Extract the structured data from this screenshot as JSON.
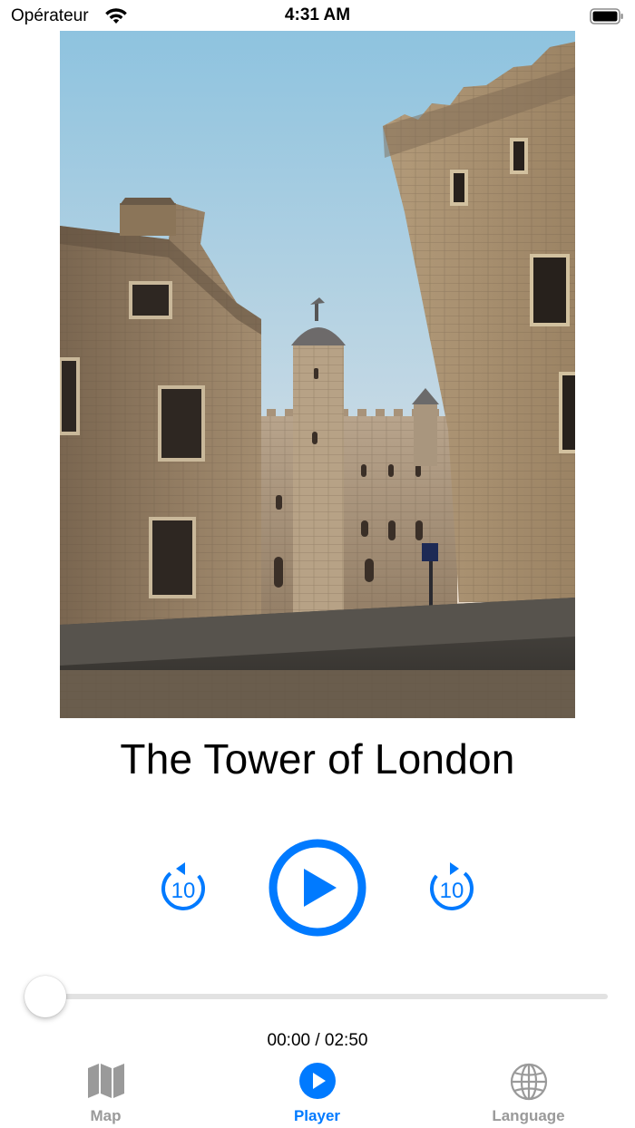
{
  "status_bar": {
    "carrier": "Opérateur",
    "time": "4:31 AM"
  },
  "track": {
    "title": "The Tower of London"
  },
  "player": {
    "elapsed": "00:00",
    "duration": "02:50",
    "time_display": "00:00 / 02:50",
    "skip_back_label": "10",
    "skip_forward_label": "10",
    "progress": 0.0
  },
  "tabs": [
    {
      "label": "Map",
      "icon": "map-icon",
      "active": false
    },
    {
      "label": "Player",
      "icon": "play-circle-icon",
      "active": true
    },
    {
      "label": "Language",
      "icon": "globe-icon",
      "active": false
    }
  ],
  "colors": {
    "accent": "#007aff",
    "inactive": "#9a9a9a"
  }
}
